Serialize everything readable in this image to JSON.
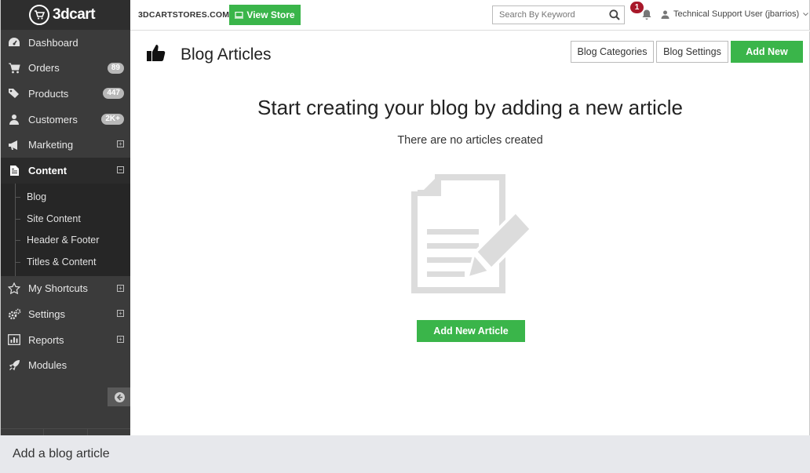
{
  "brand": {
    "logo_text": "3dcart"
  },
  "topbar": {
    "store_name": "3DCARTSTORES.COM",
    "view_store_label": "View Store",
    "search_placeholder": "Search By Keyword",
    "notification_count": "1",
    "user_name": "Technical Support User (jbarrios)"
  },
  "sidebar": {
    "items": [
      {
        "label": "Dashboard",
        "icon": "dashboard-icon"
      },
      {
        "label": "Orders",
        "icon": "cart-icon",
        "badge": "89"
      },
      {
        "label": "Products",
        "icon": "tag-icon",
        "badge": "447"
      },
      {
        "label": "Customers",
        "icon": "user-icon",
        "badge": "2K+"
      },
      {
        "label": "Marketing",
        "icon": "megaphone-icon"
      },
      {
        "label": "Content",
        "icon": "document-icon"
      },
      {
        "label": "My Shortcuts",
        "icon": "star-icon"
      },
      {
        "label": "Settings",
        "icon": "gears-icon"
      },
      {
        "label": "Reports",
        "icon": "bar-chart-icon"
      },
      {
        "label": "Modules",
        "icon": "rocket-icon"
      }
    ],
    "content_subitems": [
      "Blog",
      "Site Content",
      "Header & Footer",
      "Titles & Content"
    ]
  },
  "main": {
    "page_title": "Blog Articles",
    "blog_categories_label": "Blog Categories",
    "blog_settings_label": "Blog Settings",
    "add_new_label": "Add New",
    "empty_title": "Start creating your blog by adding a new article",
    "empty_subtitle": "There are no articles created",
    "add_article_label": "Add New Article"
  },
  "caption": "Add a blog article",
  "colors": {
    "accent_green": "#3ab54a",
    "sidebar_bg": "#3b3b3b",
    "notification_red": "#a8182a"
  }
}
